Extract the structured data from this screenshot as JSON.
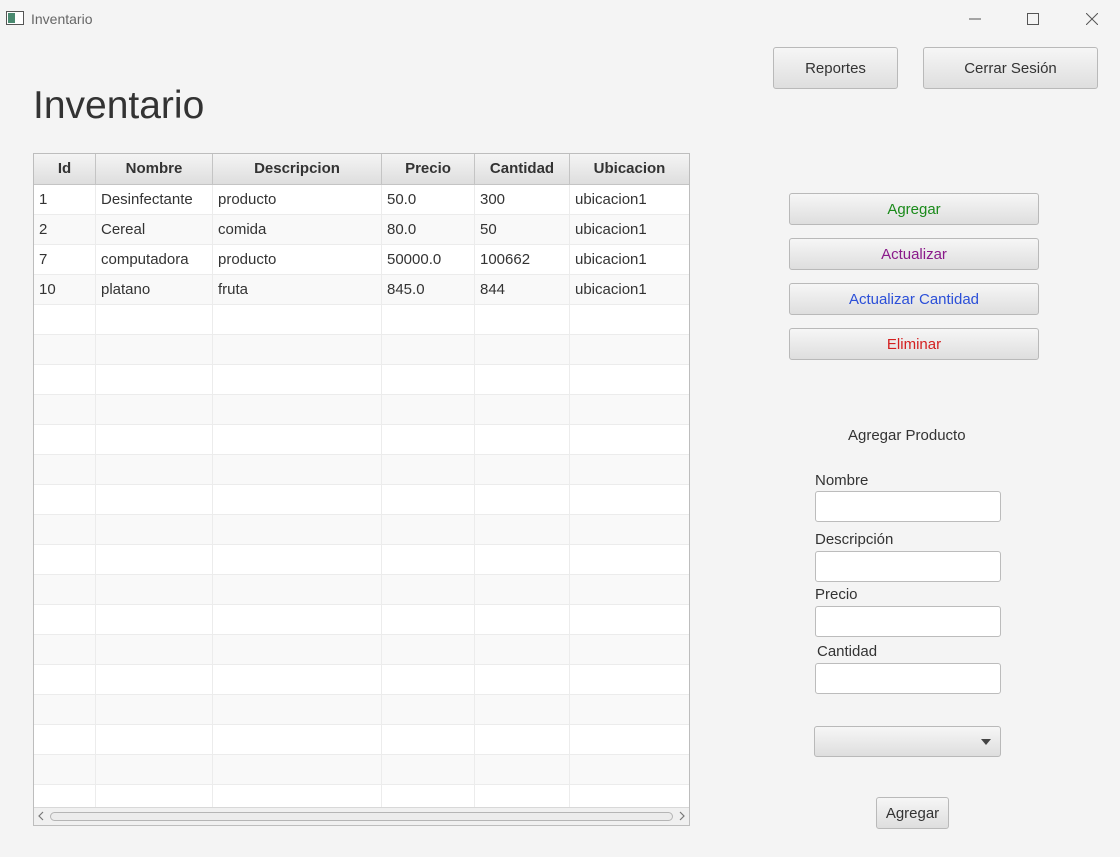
{
  "window": {
    "title": "Inventario",
    "icon": "app-window-icon"
  },
  "header": {
    "page_title": "Inventario",
    "reports_label": "Reportes",
    "logout_label": "Cerrar Sesión"
  },
  "table": {
    "columns": [
      "Id",
      "Nombre",
      "Descripcion",
      "Precio",
      "Cantidad",
      "Ubicacion"
    ],
    "rows": [
      [
        "1",
        "Desinfectante",
        "producto",
        "50.0",
        "300",
        "ubicacion1"
      ],
      [
        "2",
        "Cereal",
        "comida",
        "80.0",
        "50",
        "ubicacion1"
      ],
      [
        "7",
        "computadora",
        "producto",
        "50000.0",
        "100662",
        "ubicacion1"
      ],
      [
        "10",
        "platano",
        "fruta",
        "845.0",
        "844",
        "ubicacion1"
      ]
    ]
  },
  "actions": {
    "add": {
      "label": "Agregar",
      "color": "#1a8a1a"
    },
    "update": {
      "label": "Actualizar",
      "color": "#8a1a8a"
    },
    "update_qty": {
      "label": "Actualizar Cantidad",
      "color": "#2b4fd8"
    },
    "delete": {
      "label": "Eliminar",
      "color": "#d42020"
    }
  },
  "form": {
    "title": "Agregar Producto",
    "nombre_label": "Nombre",
    "descripcion_label": "Descripción",
    "precio_label": "Precio",
    "cantidad_label": "Cantidad",
    "nombre_value": "",
    "descripcion_value": "",
    "precio_value": "",
    "cantidad_value": "",
    "location_selected": "",
    "submit_label": "Agregar"
  }
}
